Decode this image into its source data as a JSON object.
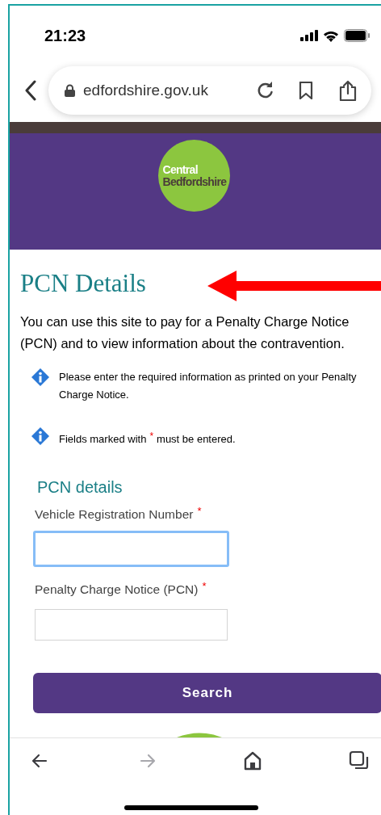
{
  "status_bar": {
    "time": "21:23"
  },
  "browser": {
    "url": "edfordshire.gov.uk"
  },
  "logo": {
    "line_1": "Central",
    "line_2": "Bedfordshire"
  },
  "page": {
    "title": "PCN Details",
    "intro": "You can use this site to pay for a Penalty Charge Notice (PCN) and to view information about the contravention.",
    "notes": [
      {
        "text_before": "Please enter the required information as printed on your Penalty Charge Notice."
      },
      {
        "text_before": "Fields marked with",
        "marker": "*",
        "text_after": "must be entered."
      }
    ],
    "section_title": "PCN details",
    "fields": [
      {
        "label": "Vehicle Registration Number",
        "required": true,
        "focused": true
      },
      {
        "label": "Penalty Charge Notice (PCN)",
        "required": true,
        "focused": false
      }
    ],
    "button": "Search"
  },
  "toolbar": [
    {
      "kind": "back",
      "disabled": false
    },
    {
      "kind": "forward",
      "disabled": true
    },
    {
      "kind": "home",
      "disabled": false
    },
    {
      "kind": "tabs",
      "disabled": false
    }
  ]
}
